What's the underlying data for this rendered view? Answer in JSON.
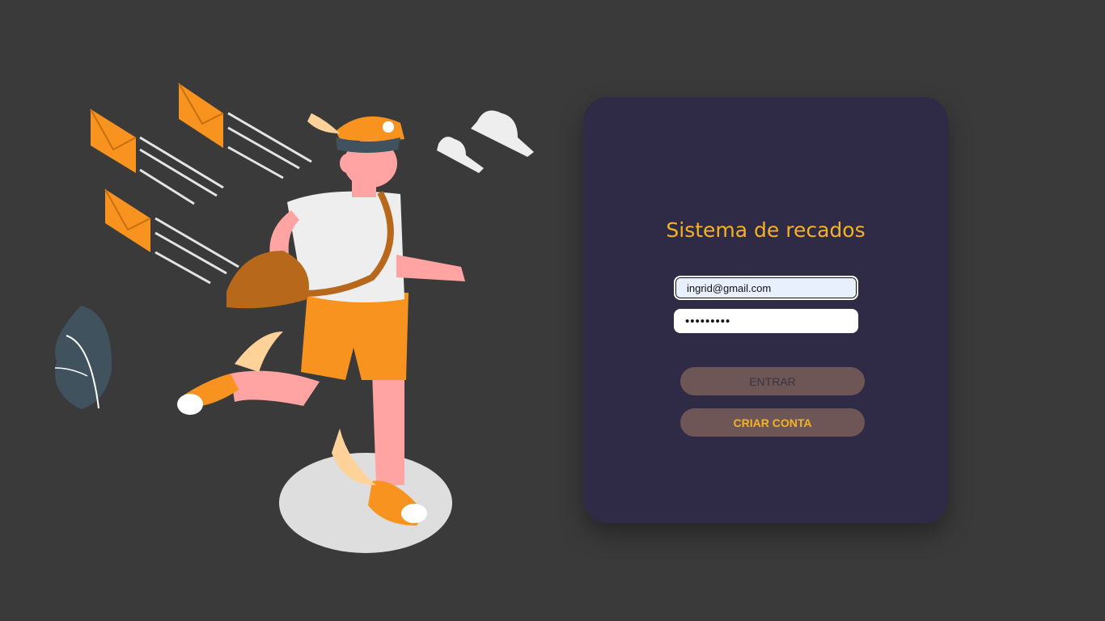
{
  "login": {
    "title": "Sistema de recados",
    "email_value": "ingrid@gmail.com",
    "password_value": "•••••••••",
    "enter_label": "ENTRAR",
    "create_label": "CRIAR CONTA"
  },
  "colors": {
    "background": "#3a3a3a",
    "card": "#2f2a45",
    "accent": "#f5b323",
    "button": "#6e5656"
  },
  "illustration": {
    "subject": "mail-courier-running-icon"
  }
}
